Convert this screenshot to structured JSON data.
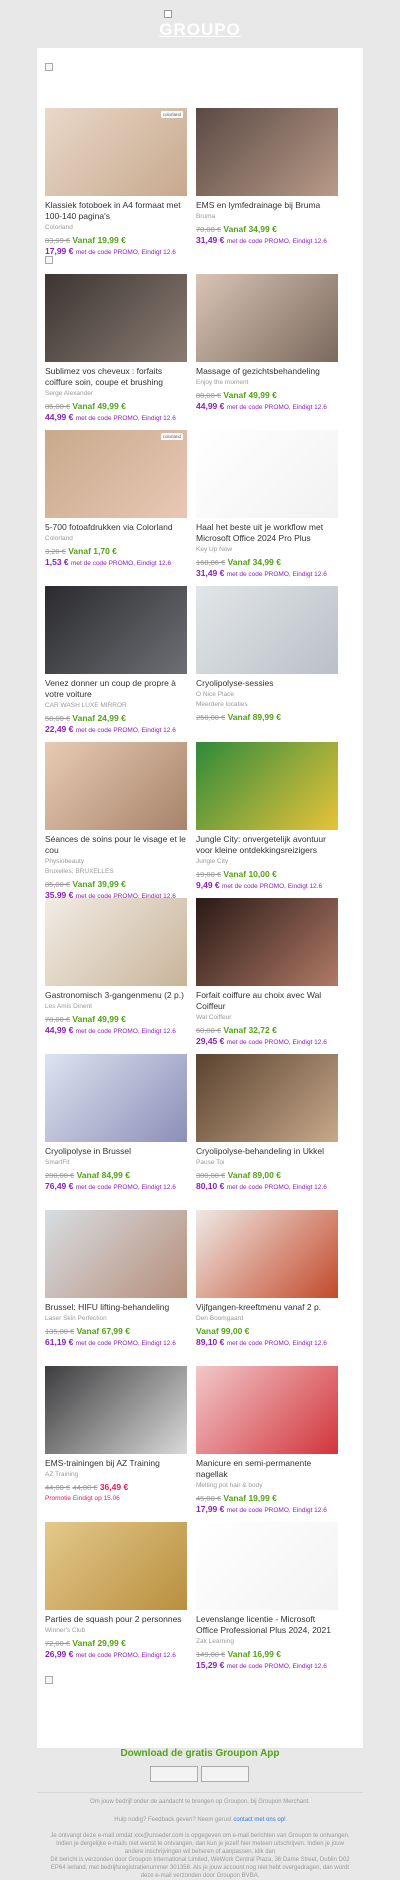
{
  "header": {
    "logo_text": "GROUPO"
  },
  "deals": [
    {
      "title": "Klassiek fotoboek in A4 formaat met 100-140 pagina's",
      "merchant": "Colorland",
      "old_price": "83,99 €",
      "new_label": "Vanaf 19,99 €",
      "promo_price": "17,99 €",
      "promo_text": "met de code PROMO, Eindigt 12.6",
      "badge": "colorland",
      "colors": [
        "#e9d8c8",
        "#c7a98e"
      ]
    },
    {
      "title": "EMS en lymfedrainage bij Bruma",
      "merchant": "Bruma",
      "old_price": "70,00 €",
      "new_label": "Vanaf 34,99 €",
      "promo_price": "31,49 €",
      "promo_text": "met de code PROMO, Eindigt 12.6",
      "colors": [
        "#5a4a44",
        "#b99a88"
      ]
    },
    {
      "title": "Sublimez vos cheveux : forfaits coiffure soin, coupe et brushing",
      "merchant": "Serge Alexander",
      "old_price": "85,00 €",
      "new_label": "Vanaf 49,99 €",
      "promo_price": "44,99 €",
      "promo_text": "met de code PROMO, Eindigt 12.6",
      "colors": [
        "#3c3532",
        "#8b7c72"
      ]
    },
    {
      "title": "Massage of gezichtsbehandeling",
      "merchant": "Enjoy the moment",
      "old_price": "80,00 €",
      "new_label": "Vanaf 49,99 €",
      "promo_price": "44,99 €",
      "promo_text": "met de code PROMO, Eindigt 12.6",
      "colors": [
        "#d9c3b4",
        "#7a6a5e"
      ]
    },
    {
      "title": "5-700 fotoafdrukken via Colorland",
      "merchant": "Colorland",
      "old_price": "3,20 €",
      "new_label": "Vanaf 1,70 €",
      "promo_price": "1,53 €",
      "promo_text": "met de code PROMO, Eindigt 12.6",
      "badge": "colorland",
      "colors": [
        "#c9a98b",
        "#e9c7b5"
      ]
    },
    {
      "title": "Haal het beste uit je workflow met Microsoft Office 2024 Pro Plus",
      "merchant": "Key Up Now",
      "old_price": "168,86 €",
      "new_label": "Vanaf 34,99 €",
      "promo_price": "31,49 €",
      "promo_text": "met de code PROMO, Eindigt 12.6",
      "colors": [
        "#ffffff",
        "#f2f2f2"
      ]
    },
    {
      "title": "Venez donner un coup de propre à votre voiture",
      "merchant": "CAR WASH LUXE MIRROR",
      "old_price": "50,00 €",
      "new_label": "Vanaf 24,99 €",
      "promo_price": "22,49 €",
      "promo_text": "met de code PROMO, Eindigt 12.6",
      "colors": [
        "#2b2b2e",
        "#6d6f74"
      ]
    },
    {
      "title": "Cryolipolyse-sessies",
      "merchant": "Meerdere locaties",
      "merchant_line1": "O Nice Place",
      "old_price": "250,00 €",
      "new_label": "Vanaf 89,99 €",
      "colors": [
        "#e3e6e8",
        "#b9c0c6"
      ]
    },
    {
      "title": "Séances de soins pour le visage et le cou",
      "merchant": "Bruxelles, BRUXELLES",
      "merchant_line1": "Physiobeauty",
      "old_price": "85,00 €",
      "new_label": "Vanaf 39,99 €",
      "promo_price": "35,99 €",
      "promo_text": "met de code PROMO, Eindigt 12.6",
      "colors": [
        "#e8cbb3",
        "#a7836a"
      ]
    },
    {
      "title": "Jungle City: onvergetelijk avontuur voor kleine ontdekkingsreizigers",
      "merchant": "Jungle City",
      "old_price": "19,00 €",
      "new_label": "Vanaf 10,00 €",
      "promo_price": "9,49 €",
      "promo_text": "met de code PROMO, Eindigt 12.6",
      "colors": [
        "#2f8a3a",
        "#e8c33a"
      ]
    },
    {
      "title": "Gastronomisch 3-gangenmenu (2 p.)",
      "merchant": "Les Amis Dinent",
      "old_price": "78,00 €",
      "new_label": "Vanaf 49,99 €",
      "promo_price": "44,99 €",
      "promo_text": "met de code PROMO, Eindigt 12.6",
      "colors": [
        "#f1ece4",
        "#c9b49a"
      ]
    },
    {
      "title": "Forfait coiffure au choix avec Wal Coiffeur",
      "merchant": "Wal Coiffeur",
      "old_price": "60,00 €",
      "new_label": "Vanaf 32,72 €",
      "promo_price": "29,45 €",
      "promo_text": "met de code PROMO, Eindigt 12.6",
      "colors": [
        "#2a1a16",
        "#b07a66"
      ]
    },
    {
      "title": "Cryolipolyse in Brussel",
      "merchant": "SmartFit",
      "old_price": "200,00 €",
      "new_label": "Vanaf 84,99 €",
      "promo_price": "76,49 €",
      "promo_text": "met de code PROMO, Eindigt 12.6",
      "colors": [
        "#dce3f0",
        "#8c8fb8"
      ]
    },
    {
      "title": "Cryolipolyse-behandeling in Ukkel",
      "merchant": "Pause Toi",
      "old_price": "300,00 €",
      "new_label": "Vanaf 89,00 €",
      "promo_price": "80,10 €",
      "promo_text": "met de code PROMO, Eindigt 12.6",
      "colors": [
        "#5b4330",
        "#c7a88a"
      ]
    },
    {
      "title": "Brussel: HIFU lifting-behandeling",
      "merchant": "Laser Skin Perfection",
      "old_price": "135,00 €",
      "new_label": "Vanaf 67,99 €",
      "promo_price": "61,19 €",
      "promo_text": "met de code PROMO, Eindigt 12.6",
      "colors": [
        "#d7dde2",
        "#b68f7a"
      ]
    },
    {
      "title": "Vijfgangen-kreeftmenu vanaf 2 p.",
      "merchant": "Den Boomgaard",
      "new_label": "Vanaf 99,00 €",
      "promo_price": "89,10 €",
      "promo_text": "met de code PROMO, Eindigt 12.6",
      "colors": [
        "#eee9e4",
        "#c34a2c"
      ]
    },
    {
      "title": "EMS-trainingen bij AZ Training",
      "merchant": "AZ Training",
      "old_price": "44,00 €",
      "old2_price": "44,00 €",
      "red_new": "36,49 €",
      "promo_red": "Promotie Eindigt op 15.06",
      "colors": [
        "#3d3d3f",
        "#d9d9d9"
      ]
    },
    {
      "title": "Manicure en semi-permanente nagellak",
      "merchant": "Melting pot hair & body",
      "old_price": "45,00 €",
      "new_label": "Vanaf 19,99 €",
      "promo_price": "17,99 €",
      "promo_text": "met de code PROMO, Eindigt 12.6",
      "colors": [
        "#f2c7c9",
        "#d2353b"
      ]
    },
    {
      "title": "Parties de squash pour 2 personnes",
      "merchant": "Winner's Club",
      "old_price": "72,00 €",
      "new_label": "Vanaf 29,99 €",
      "promo_price": "26,99 €",
      "promo_text": "met de code PROMO, Eindigt 12.6",
      "colors": [
        "#e3c98a",
        "#b98f3f"
      ]
    },
    {
      "title": "Levenslange licentie - Microsoft Office Professional Plus 2024, 2021",
      "merchant": "Zak Learning",
      "old_price": "149,00 €",
      "new_label": "Vanaf 16,99 €",
      "promo_price": "15,29 €",
      "promo_text": "met de code PROMO, Eindigt 12.6",
      "colors": [
        "#ffffff",
        "#f3f3f3"
      ]
    }
  ],
  "footer": {
    "download": "Download de gratis Groupon App",
    "merchant_line": "Om jouw bedrijf onder de aandacht te brengen op Groupon, bij Groupon Merchant.",
    "help_prefix": "Hulp nodig? Feedback geven? Neem gerust",
    "help_link": "contact met ons op!",
    "received": "Je ontvangt deze e-mail omdat xxx@unseder.com is opgegeven om e-mail berichten van Groupon te ontvangen. Indien je dergelijke e-mails niet wenst te ontvangen, dan kun je jezelf hier meteen uitschrijven. Indien je jouw andere inschrijvingen wil beheren of aanpassen, klik dan",
    "sent_by": "Dit bericht is verzonden door Groupon International Limited, WeWork Central Plaza, 36 Dame Street, Dublin D02 EP64 Ierland, met bedrijfsregistratienummer 301358. Als je jouw account nog niet hebt overgedragen, dan wordt deze e-mail verzonden door Groupon BVBA."
  },
  "brand_colors": {
    "green": "#53a318",
    "purple": "#8c22b8",
    "red": "#e01e5a"
  }
}
